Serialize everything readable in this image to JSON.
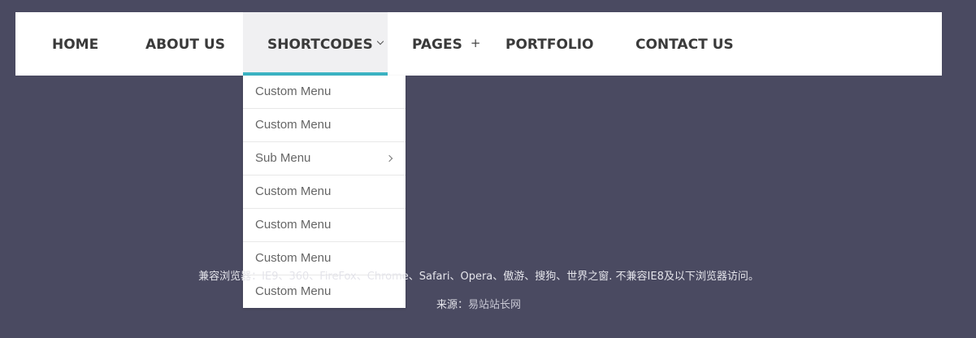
{
  "nav": {
    "home": "HOME",
    "about": "ABOUT US",
    "shortcodes": "SHORTCODES",
    "pages": "PAGES",
    "pages_icon": "+",
    "portfolio": "PORTFOLIO",
    "contact": "CONTACT US"
  },
  "dropdown": {
    "items": [
      {
        "label": "Custom Menu"
      },
      {
        "label": "Custom Menu"
      },
      {
        "label": "Sub Menu",
        "has_submenu": true
      },
      {
        "label": "Custom Menu"
      },
      {
        "label": "Custom Menu"
      },
      {
        "label": "Custom Menu"
      },
      {
        "label": "Custom Menu"
      }
    ]
  },
  "footer": {
    "compat_text": "兼容浏览器：IE9、360、FireFox、Chrome、Safari、Opera、傲游、搜狗、世界之窗. 不兼容IE8及以下浏览器访问。",
    "source_label": "来源：",
    "source_link": "易站站长网"
  },
  "colors": {
    "background": "#4a4a61",
    "accent": "#3bb3c3",
    "nav_bg": "#ffffff",
    "active_bg": "#f0f0f2"
  },
  "icons": {
    "shortcodes": "chevron-down-icon",
    "pages": "plus-icon",
    "sub_menu": "chevron-right-icon"
  }
}
